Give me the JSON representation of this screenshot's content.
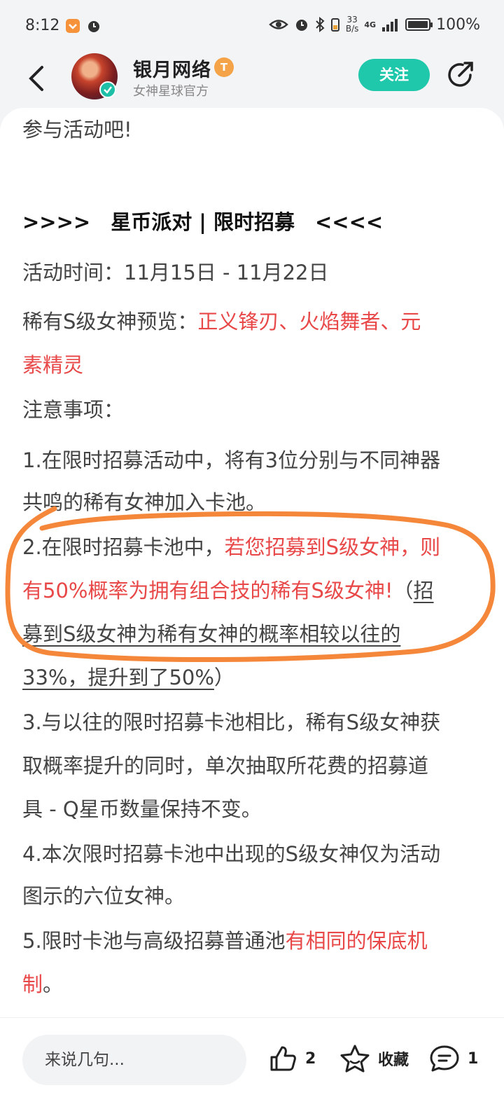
{
  "status_bar": {
    "time": "8:12",
    "net_speed_value": "33",
    "net_speed_unit": "B/s",
    "network": "4G",
    "battery": "100%"
  },
  "header": {
    "back_icon": "chevron-left-icon",
    "name": "银月网络",
    "level_badge": "T",
    "subtitle": "女神星球官方",
    "follow_label": "关注",
    "share_icon": "share-icon"
  },
  "article": {
    "line1": "参与活动吧!",
    "heading": ">>>>　星币派对 | 限时招募　<<<<",
    "time": "活动时间：11月15日 - 11月22日",
    "preview_label": "稀有S级女神预览：",
    "preview_names_1": "正义锋刃、火焰舞者、元",
    "preview_names_2": "素精灵",
    "notes_title": "注意事项：",
    "n1_l1": "1.在限时招募活动中，将有3位分别与不同神器",
    "n1_l2": "共鸣的稀有女神加入卡池。",
    "n2_l1_a": "2.在限时招募卡池中，",
    "n2_l1_b": "若您招募到S级女神，则",
    "n2_l2_a": "有50%概率为拥有组合技的稀有S级女神!",
    "n2_l2_b": "（",
    "n2_l2_c": "招",
    "n2_l3": "募到S级女神为稀有女神的概率相较以往的",
    "n2_l4_a": "33%，提升到了50%",
    "n2_l4_b": "）",
    "n3_l1": "3.与以往的限时招募卡池相比，稀有S级女神获",
    "n3_l2": "取概率提升的同时，单次抽取所花费的招募道",
    "n3_l3": "具 - Q星币数量保持不变。",
    "n4_l1": "4.本次限时招募卡池中出现的S级女神仅为活动",
    "n4_l2": "图示的六位女神。",
    "n5_l1_a": "5.限时卡池与高级招募普通池",
    "n5_l1_b": "有相同的保底机",
    "n5_l2_a": "制",
    "n5_l2_b": "。"
  },
  "bottom_bar": {
    "comment_placeholder": "来说几句...",
    "like_count": "2",
    "favorite_label": "收藏",
    "comment_count": "1"
  },
  "colors": {
    "accent": "#1fc8ab",
    "highlight_red": "#e84848",
    "annotation_orange": "#f5873a"
  }
}
